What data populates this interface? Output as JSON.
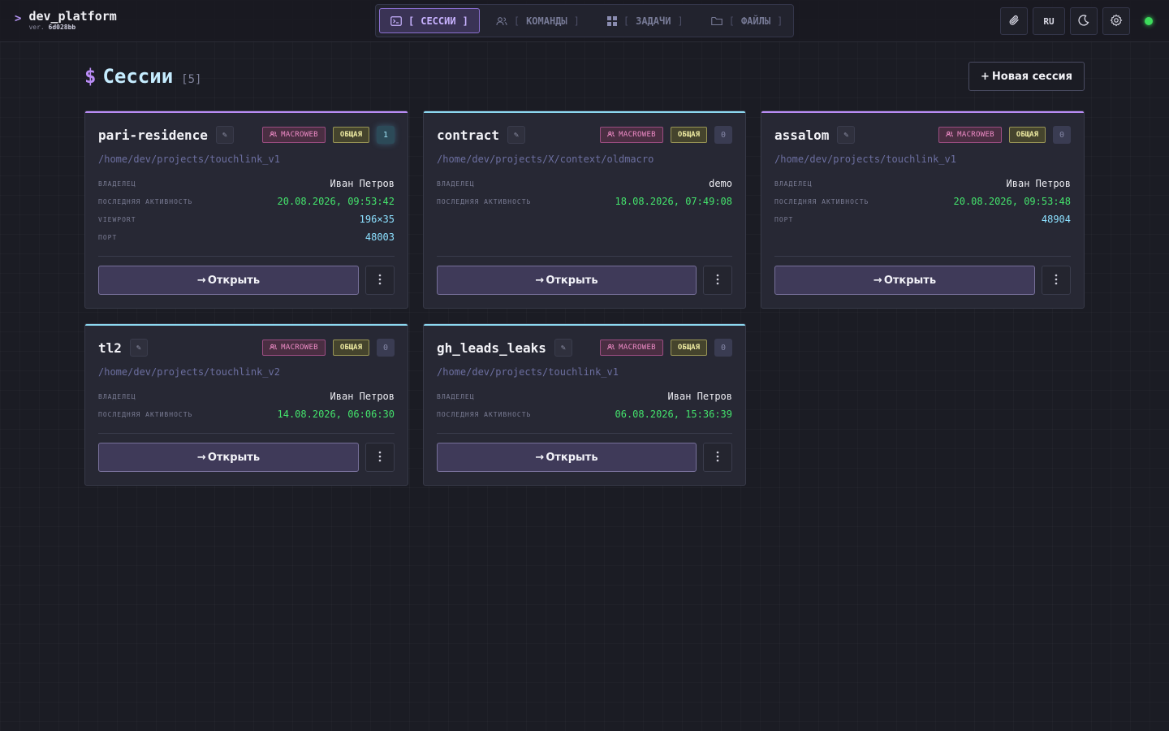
{
  "brand": {
    "prompt": ">",
    "name": "dev_platform",
    "ver_label": "ver.",
    "ver_hash": "6d028bb"
  },
  "nav": [
    {
      "label": "СЕССИИ",
      "icon": "terminal-icon",
      "active": true
    },
    {
      "label": "КОМАНДЫ",
      "icon": "users-icon",
      "active": false
    },
    {
      "label": "ЗАДАЧИ",
      "icon": "grid-icon",
      "active": false
    },
    {
      "label": "ФАЙЛЫ",
      "icon": "folder-icon",
      "active": false
    }
  ],
  "header_right": {
    "lang": "RU",
    "icons": [
      "paperclip-icon",
      "moon-icon",
      "gear-icon"
    ],
    "status_color": "#3ddc5c"
  },
  "page": {
    "dollar": "$",
    "title": "Сессии",
    "count": "[5]",
    "new_button": "Новая сессия",
    "new_button_icon": "+"
  },
  "labels": {
    "owner": "ВЛАДЕЛЕЦ",
    "last_activity": "ПОСЛЕДНЯЯ АКТИВНОСТЬ",
    "viewport": "VIEWPORT",
    "port": "ПОРТ",
    "open": "Открыть",
    "open_icon": "→"
  },
  "colors": {
    "accent_purple": "#b98cf5",
    "accent_cyan": "#8cd8f0",
    "time_green": "#44e36c"
  },
  "sessions": [
    {
      "name": "pari-residence",
      "team": "MACROWEB",
      "shared": "ОБЩАЯ",
      "count": "1",
      "count_active": true,
      "path": "/home/dev/projects/touchlink_v1",
      "owner": "Иван Петров",
      "last_activity": "20.08.2026, 09:53:42",
      "viewport": "196×35",
      "port": "48003",
      "accent": "#b98cf5"
    },
    {
      "name": "contract",
      "team": "MACROWEB",
      "shared": "ОБЩАЯ",
      "count": "0",
      "count_active": false,
      "path": "/home/dev/projects/X/context/oldmacro",
      "owner": "demo",
      "last_activity": "18.08.2026, 07:49:08",
      "accent": "#8cd8f0"
    },
    {
      "name": "assalom",
      "team": "MACROWEB",
      "shared": "ОБЩАЯ",
      "count": "0",
      "count_active": false,
      "path": "/home/dev/projects/touchlink_v1",
      "owner": "Иван Петров",
      "last_activity": "20.08.2026, 09:53:48",
      "port": "48904",
      "accent": "#b98cf5"
    },
    {
      "name": "tl2",
      "team": "MACROWEB",
      "shared": "ОБЩАЯ",
      "count": "0",
      "count_active": false,
      "path": "/home/dev/projects/touchlink_v2",
      "owner": "Иван Петров",
      "last_activity": "14.08.2026, 06:06:30",
      "accent": "#8cd8f0"
    },
    {
      "name": "gh_leads_leaks",
      "team": "MACROWEB",
      "shared": "ОБЩАЯ",
      "count": "0",
      "count_active": false,
      "path": "/home/dev/projects/touchlink_v1",
      "owner": "Иван Петров",
      "last_activity": "06.08.2026, 15:36:39",
      "accent": "#8cd8f0"
    }
  ]
}
